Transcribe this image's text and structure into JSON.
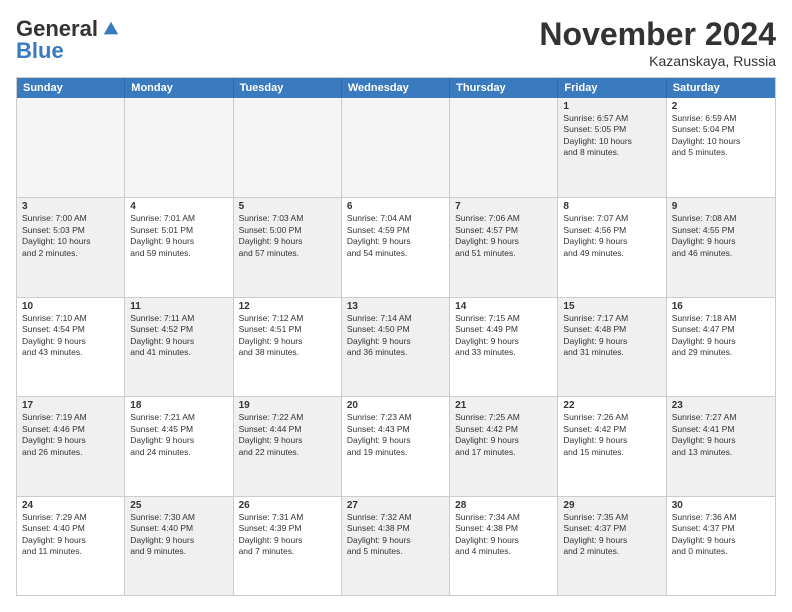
{
  "logo": {
    "general": "General",
    "blue": "Blue"
  },
  "title": "November 2024",
  "location": "Kazanskaya, Russia",
  "headers": [
    "Sunday",
    "Monday",
    "Tuesday",
    "Wednesday",
    "Thursday",
    "Friday",
    "Saturday"
  ],
  "rows": [
    [
      {
        "day": "",
        "info": "",
        "empty": true
      },
      {
        "day": "",
        "info": "",
        "empty": true
      },
      {
        "day": "",
        "info": "",
        "empty": true
      },
      {
        "day": "",
        "info": "",
        "empty": true
      },
      {
        "day": "",
        "info": "",
        "empty": true
      },
      {
        "day": "1",
        "info": "Sunrise: 6:57 AM\nSunset: 5:05 PM\nDaylight: 10 hours\nand 8 minutes.",
        "empty": false,
        "shaded": true
      },
      {
        "day": "2",
        "info": "Sunrise: 6:59 AM\nSunset: 5:04 PM\nDaylight: 10 hours\nand 5 minutes.",
        "empty": false,
        "shaded": false
      }
    ],
    [
      {
        "day": "3",
        "info": "Sunrise: 7:00 AM\nSunset: 5:03 PM\nDaylight: 10 hours\nand 2 minutes.",
        "empty": false,
        "shaded": true
      },
      {
        "day": "4",
        "info": "Sunrise: 7:01 AM\nSunset: 5:01 PM\nDaylight: 9 hours\nand 59 minutes.",
        "empty": false,
        "shaded": false
      },
      {
        "day": "5",
        "info": "Sunrise: 7:03 AM\nSunset: 5:00 PM\nDaylight: 9 hours\nand 57 minutes.",
        "empty": false,
        "shaded": true
      },
      {
        "day": "6",
        "info": "Sunrise: 7:04 AM\nSunset: 4:59 PM\nDaylight: 9 hours\nand 54 minutes.",
        "empty": false,
        "shaded": false
      },
      {
        "day": "7",
        "info": "Sunrise: 7:06 AM\nSunset: 4:57 PM\nDaylight: 9 hours\nand 51 minutes.",
        "empty": false,
        "shaded": true
      },
      {
        "day": "8",
        "info": "Sunrise: 7:07 AM\nSunset: 4:56 PM\nDaylight: 9 hours\nand 49 minutes.",
        "empty": false,
        "shaded": false
      },
      {
        "day": "9",
        "info": "Sunrise: 7:08 AM\nSunset: 4:55 PM\nDaylight: 9 hours\nand 46 minutes.",
        "empty": false,
        "shaded": true
      }
    ],
    [
      {
        "day": "10",
        "info": "Sunrise: 7:10 AM\nSunset: 4:54 PM\nDaylight: 9 hours\nand 43 minutes.",
        "empty": false,
        "shaded": false
      },
      {
        "day": "11",
        "info": "Sunrise: 7:11 AM\nSunset: 4:52 PM\nDaylight: 9 hours\nand 41 minutes.",
        "empty": false,
        "shaded": true
      },
      {
        "day": "12",
        "info": "Sunrise: 7:12 AM\nSunset: 4:51 PM\nDaylight: 9 hours\nand 38 minutes.",
        "empty": false,
        "shaded": false
      },
      {
        "day": "13",
        "info": "Sunrise: 7:14 AM\nSunset: 4:50 PM\nDaylight: 9 hours\nand 36 minutes.",
        "empty": false,
        "shaded": true
      },
      {
        "day": "14",
        "info": "Sunrise: 7:15 AM\nSunset: 4:49 PM\nDaylight: 9 hours\nand 33 minutes.",
        "empty": false,
        "shaded": false
      },
      {
        "day": "15",
        "info": "Sunrise: 7:17 AM\nSunset: 4:48 PM\nDaylight: 9 hours\nand 31 minutes.",
        "empty": false,
        "shaded": true
      },
      {
        "day": "16",
        "info": "Sunrise: 7:18 AM\nSunset: 4:47 PM\nDaylight: 9 hours\nand 29 minutes.",
        "empty": false,
        "shaded": false
      }
    ],
    [
      {
        "day": "17",
        "info": "Sunrise: 7:19 AM\nSunset: 4:46 PM\nDaylight: 9 hours\nand 26 minutes.",
        "empty": false,
        "shaded": true
      },
      {
        "day": "18",
        "info": "Sunrise: 7:21 AM\nSunset: 4:45 PM\nDaylight: 9 hours\nand 24 minutes.",
        "empty": false,
        "shaded": false
      },
      {
        "day": "19",
        "info": "Sunrise: 7:22 AM\nSunset: 4:44 PM\nDaylight: 9 hours\nand 22 minutes.",
        "empty": false,
        "shaded": true
      },
      {
        "day": "20",
        "info": "Sunrise: 7:23 AM\nSunset: 4:43 PM\nDaylight: 9 hours\nand 19 minutes.",
        "empty": false,
        "shaded": false
      },
      {
        "day": "21",
        "info": "Sunrise: 7:25 AM\nSunset: 4:42 PM\nDaylight: 9 hours\nand 17 minutes.",
        "empty": false,
        "shaded": true
      },
      {
        "day": "22",
        "info": "Sunrise: 7:26 AM\nSunset: 4:42 PM\nDaylight: 9 hours\nand 15 minutes.",
        "empty": false,
        "shaded": false
      },
      {
        "day": "23",
        "info": "Sunrise: 7:27 AM\nSunset: 4:41 PM\nDaylight: 9 hours\nand 13 minutes.",
        "empty": false,
        "shaded": true
      }
    ],
    [
      {
        "day": "24",
        "info": "Sunrise: 7:29 AM\nSunset: 4:40 PM\nDaylight: 9 hours\nand 11 minutes.",
        "empty": false,
        "shaded": false
      },
      {
        "day": "25",
        "info": "Sunrise: 7:30 AM\nSunset: 4:40 PM\nDaylight: 9 hours\nand 9 minutes.",
        "empty": false,
        "shaded": true
      },
      {
        "day": "26",
        "info": "Sunrise: 7:31 AM\nSunset: 4:39 PM\nDaylight: 9 hours\nand 7 minutes.",
        "empty": false,
        "shaded": false
      },
      {
        "day": "27",
        "info": "Sunrise: 7:32 AM\nSunset: 4:38 PM\nDaylight: 9 hours\nand 5 minutes.",
        "empty": false,
        "shaded": true
      },
      {
        "day": "28",
        "info": "Sunrise: 7:34 AM\nSunset: 4:38 PM\nDaylight: 9 hours\nand 4 minutes.",
        "empty": false,
        "shaded": false
      },
      {
        "day": "29",
        "info": "Sunrise: 7:35 AM\nSunset: 4:37 PM\nDaylight: 9 hours\nand 2 minutes.",
        "empty": false,
        "shaded": true
      },
      {
        "day": "30",
        "info": "Sunrise: 7:36 AM\nSunset: 4:37 PM\nDaylight: 9 hours\nand 0 minutes.",
        "empty": false,
        "shaded": false
      }
    ]
  ]
}
